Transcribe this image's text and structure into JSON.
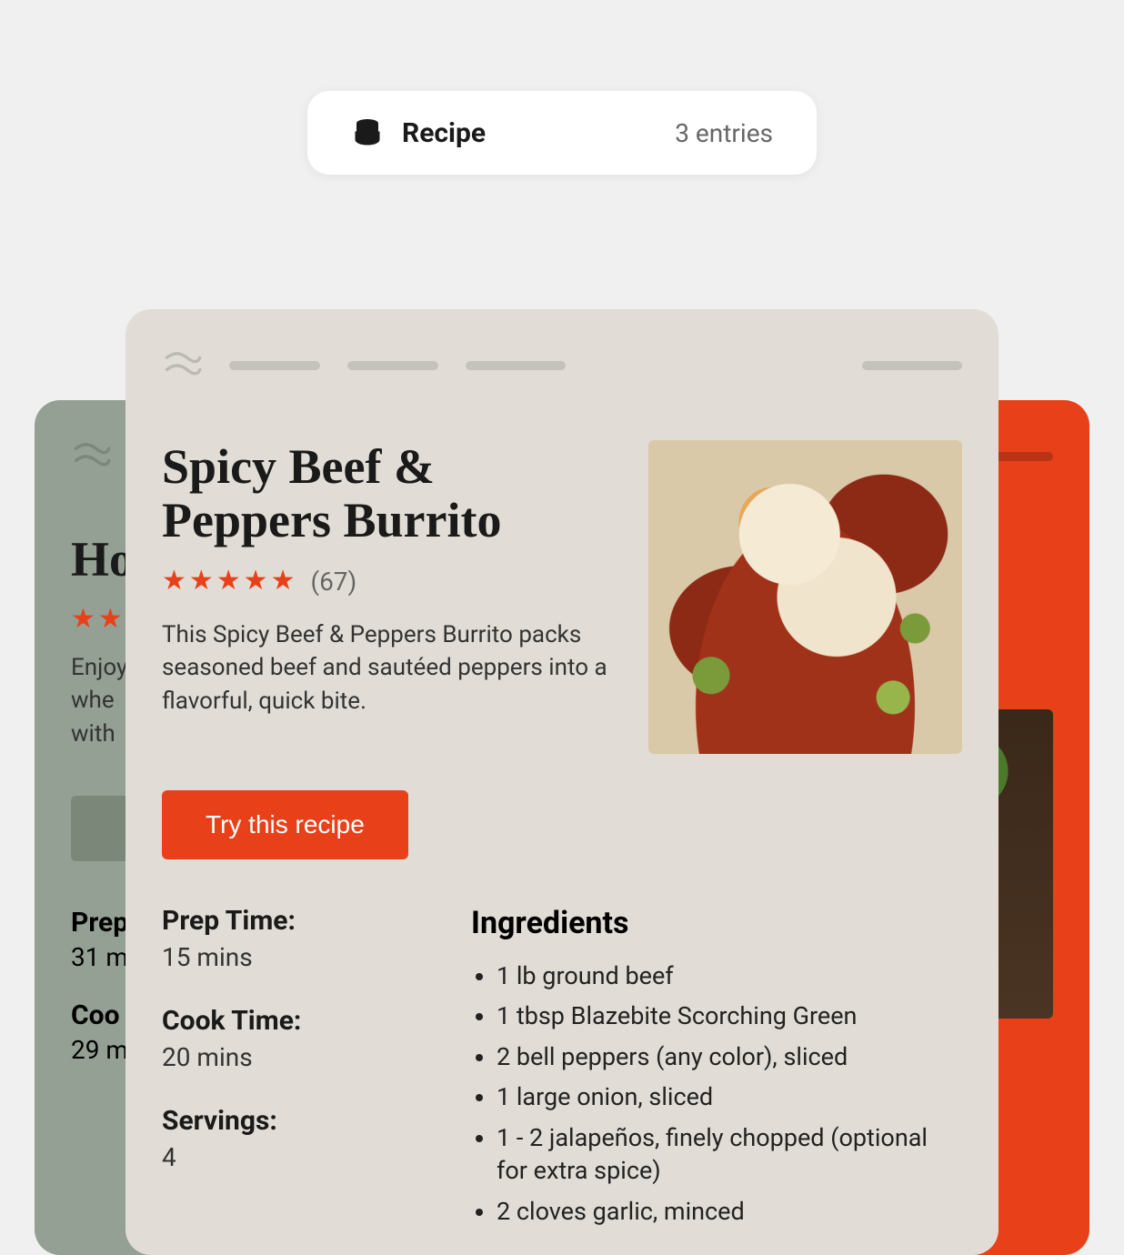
{
  "badge": {
    "title": "Recipe",
    "count_text": "3 entries"
  },
  "front_card": {
    "title": "Spicy Beef & Peppers Burrito",
    "stars": "★★★★★",
    "rating_count": "(67)",
    "description": "This Spicy Beef & Peppers Burrito packs seasoned beef and sautéed peppers into a flavorful, quick bite.",
    "cta_label": "Try this recipe",
    "prep_label": "Prep Time:",
    "prep_value": "15 mins",
    "cook_label": "Cook Time:",
    "cook_value": "20 mins",
    "servings_label": "Servings:",
    "servings_value": "4",
    "ingredients_title": "Ingredients",
    "ingredients": [
      "1 lb ground beef",
      "1 tbsp Blazebite Scorching Green",
      "2 bell peppers (any color), sliced",
      "1 large onion, sliced",
      "1 - 2 jalapeños, finely chopped (optional for extra spice)",
      "2 cloves garlic, minced"
    ]
  },
  "back_left": {
    "title_fragment": "Ho",
    "stars": "★★",
    "desc_fragment_l1": "Enjoy",
    "desc_fragment_l2": "whe",
    "desc_fragment_l3": "with",
    "prep_label": "Prep",
    "prep_value": "31 m",
    "cook_label": "Coo",
    "cook_value": "29 m"
  }
}
